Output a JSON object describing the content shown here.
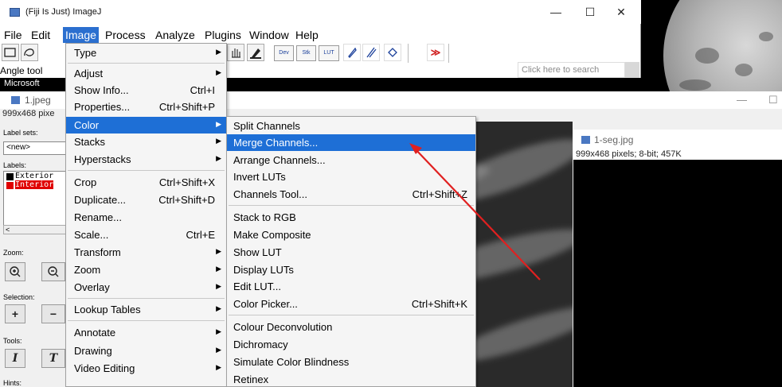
{
  "window": {
    "title": "(Fiji Is Just) ImageJ",
    "minimize": "—",
    "maximize": "☐",
    "close": "✕"
  },
  "menubar": [
    "File",
    "Edit",
    "Image",
    "Process",
    "Analyze",
    "Plugins",
    "Window",
    "Help"
  ],
  "toolbar": {
    "dev": "Dev",
    "stk": "Stk",
    "lut": "LUT",
    "more": "≫"
  },
  "status": {
    "text": "Angle tool",
    "sub": "Microsoft"
  },
  "search": {
    "placeholder": "Click here to search"
  },
  "image_window": {
    "title": "1.jpeg",
    "info": "999x468 pixe"
  },
  "label_panel": {
    "label_sets": "Label sets:",
    "select_value": "<new>",
    "labels": "Labels:",
    "items": [
      {
        "name": "Exterior",
        "color": "#000000"
      },
      {
        "name": "Interior",
        "color": "#e00000"
      }
    ],
    "scroll": "<",
    "zoom": "Zoom:",
    "selection": "Selection:",
    "tools": "Tools:",
    "hints": "Hints:"
  },
  "seg_window": {
    "title": "1-seg.jpg",
    "info": "999x468 pixels; 8-bit; 457K"
  },
  "image_menu": [
    {
      "label": "Type",
      "shortcut": "",
      "sub": true
    },
    {
      "label": "Adjust",
      "shortcut": "",
      "sub": true
    },
    {
      "label": "Show Info...",
      "shortcut": "Ctrl+I",
      "sub": false
    },
    {
      "label": "Properties...",
      "shortcut": "Ctrl+Shift+P",
      "sub": false
    },
    {
      "label": "Color",
      "shortcut": "",
      "sub": true
    },
    {
      "label": "Stacks",
      "shortcut": "",
      "sub": true
    },
    {
      "label": "Hyperstacks",
      "shortcut": "",
      "sub": true
    },
    {
      "label": "Crop",
      "shortcut": "Ctrl+Shift+X",
      "sub": false
    },
    {
      "label": "Duplicate...",
      "shortcut": "Ctrl+Shift+D",
      "sub": false
    },
    {
      "label": "Rename...",
      "shortcut": "",
      "sub": false
    },
    {
      "label": "Scale...",
      "shortcut": "Ctrl+E",
      "sub": false
    },
    {
      "label": "Transform",
      "shortcut": "",
      "sub": true
    },
    {
      "label": "Zoom",
      "shortcut": "",
      "sub": true
    },
    {
      "label": "Overlay",
      "shortcut": "",
      "sub": true
    },
    {
      "label": "Lookup Tables",
      "shortcut": "",
      "sub": true
    },
    {
      "label": "Annotate",
      "shortcut": "",
      "sub": true
    },
    {
      "label": "Drawing",
      "shortcut": "",
      "sub": true
    },
    {
      "label": "Video Editing",
      "shortcut": "",
      "sub": true
    }
  ],
  "color_submenu": [
    {
      "label": "Split Channels",
      "shortcut": ""
    },
    {
      "label": "Merge Channels...",
      "shortcut": ""
    },
    {
      "label": "Arrange Channels...",
      "shortcut": ""
    },
    {
      "label": "Invert LUTs",
      "shortcut": ""
    },
    {
      "label": "Channels Tool...",
      "shortcut": "Ctrl+Shift+Z"
    },
    {
      "label": "Stack to RGB",
      "shortcut": ""
    },
    {
      "label": "Make Composite",
      "shortcut": ""
    },
    {
      "label": "Show LUT",
      "shortcut": ""
    },
    {
      "label": "Display LUTs",
      "shortcut": ""
    },
    {
      "label": "Edit LUT...",
      "shortcut": ""
    },
    {
      "label": "Color Picker...",
      "shortcut": "Ctrl+Shift+K"
    },
    {
      "label": "Colour Deconvolution",
      "shortcut": ""
    },
    {
      "label": "Dichromacy",
      "shortcut": ""
    },
    {
      "label": "Simulate Color Blindness",
      "shortcut": ""
    },
    {
      "label": "Retinex",
      "shortcut": ""
    }
  ],
  "colors": {
    "highlight": "#1e6fd6",
    "annotation_arrow": "#e02020"
  }
}
